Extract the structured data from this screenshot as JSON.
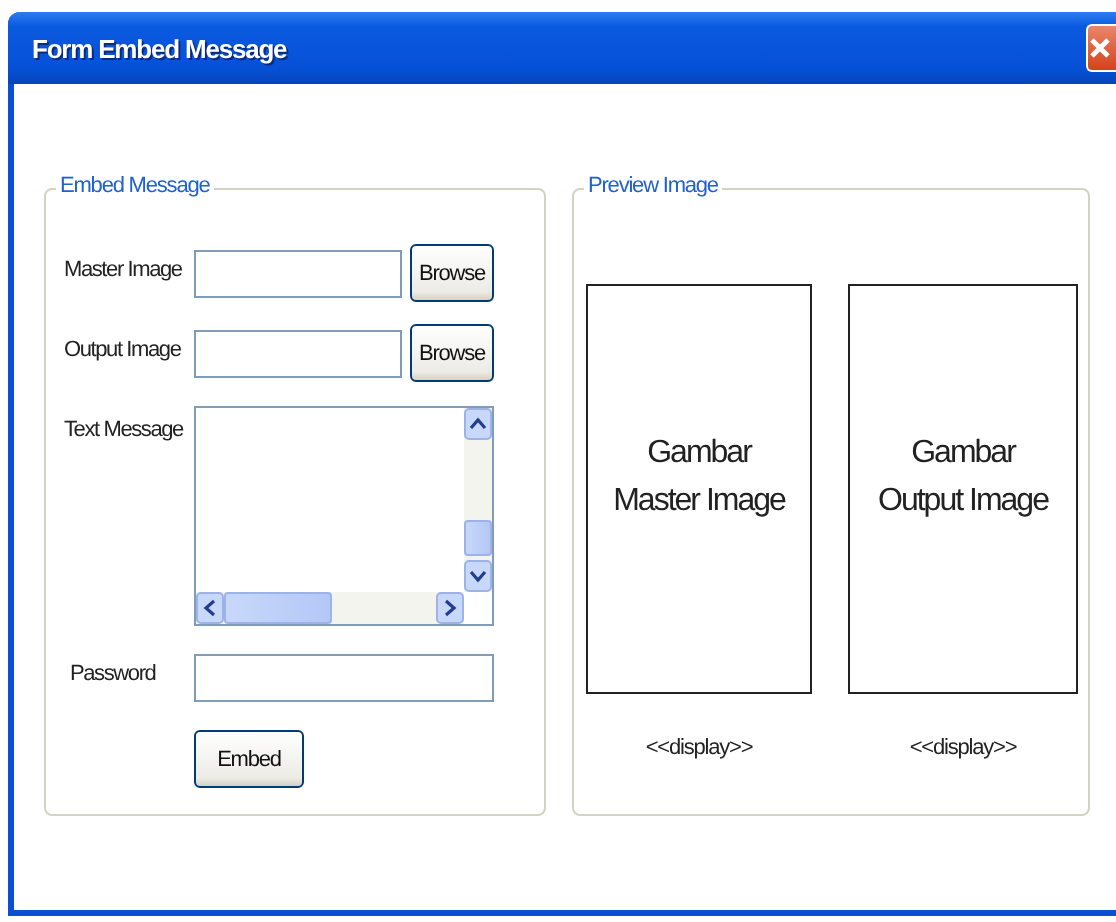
{
  "window": {
    "title": "Form Embed Message"
  },
  "embed_group": {
    "title": "Embed Message",
    "fields": [
      {
        "kind": "file",
        "label": "Master Image",
        "button": "Browse"
      },
      {
        "kind": "file",
        "label": "Output Image",
        "button": "Browse"
      },
      {
        "kind": "textarea",
        "label": "Text Message"
      },
      {
        "kind": "password",
        "label": "Password"
      }
    ],
    "button": "Embed"
  },
  "preview_group": {
    "title": "Preview Image",
    "previews": [
      {
        "text": "Gambar\nMaster Image",
        "caption": "<<display>>"
      },
      {
        "text": "Gambar\nOutput Image",
        "caption": "<<display>>"
      }
    ]
  }
}
